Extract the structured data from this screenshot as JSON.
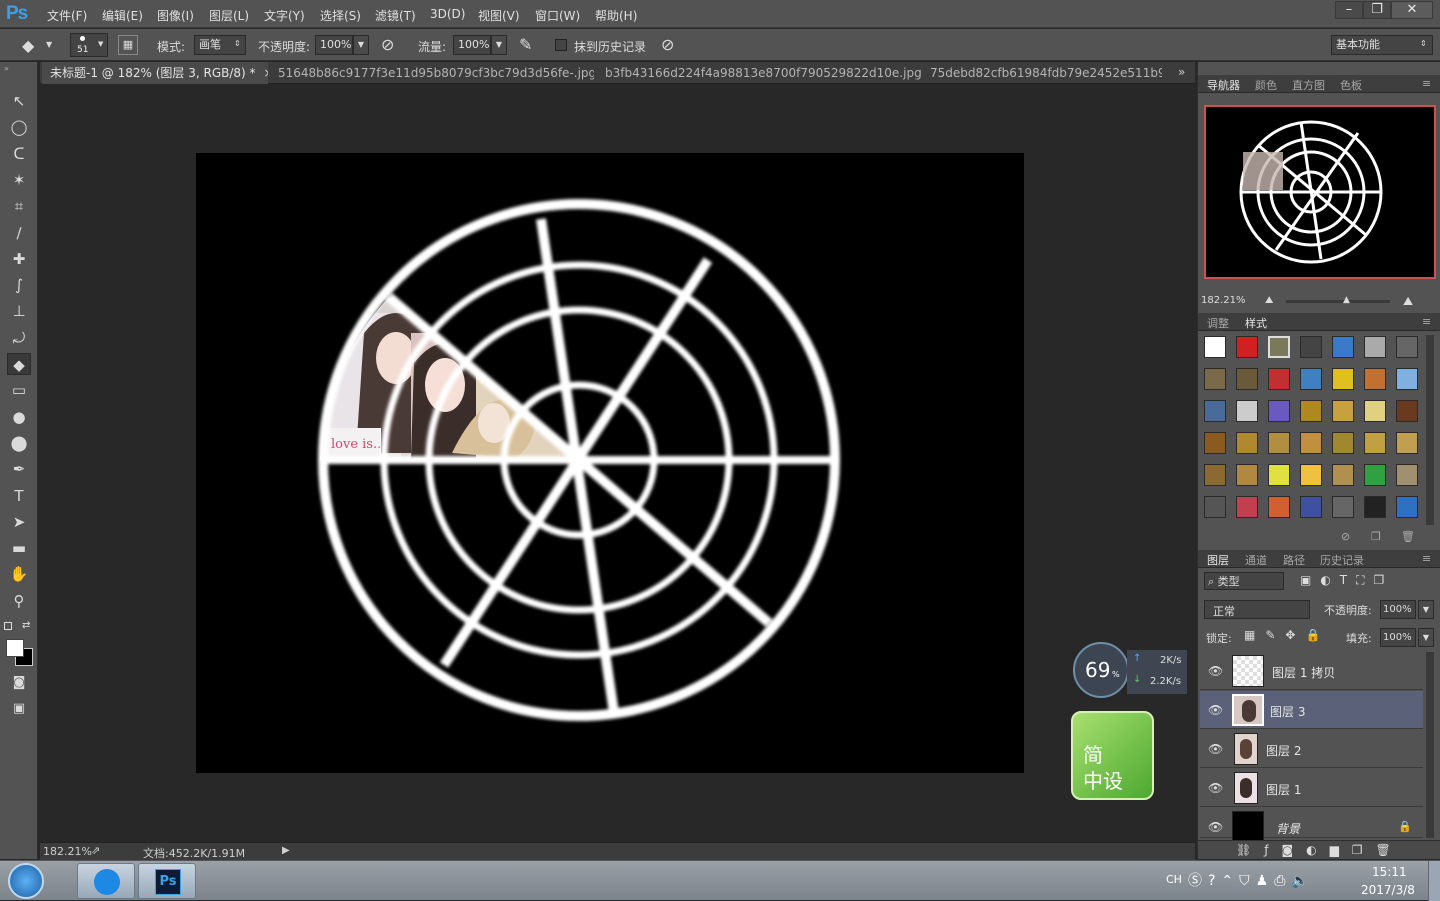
{
  "app": {
    "logo": "Ps"
  },
  "menu": [
    "文件(F)",
    "编辑(E)",
    "图像(I)",
    "图层(L)",
    "文字(Y)",
    "选择(S)",
    "滤镜(T)",
    "3D(D)",
    "视图(V)",
    "窗口(W)",
    "帮助(H)"
  ],
  "window_controls": {
    "minimize": "–",
    "restore": "❐",
    "close": "✕"
  },
  "options": {
    "brush_size": "51",
    "mode_label": "模式:",
    "mode_value": "画笔",
    "opacity_label": "不透明度:",
    "opacity_value": "100%",
    "flow_label": "流量:",
    "flow_value": "100%",
    "erase_history_label": "抹到历史记录",
    "workspace": "基本功能"
  },
  "tabs": [
    {
      "label": "未标题-1 @ 182% (图层 3, RGB/8) *",
      "close": "×"
    },
    {
      "label": "51648b86c9177f3e11d95b8079cf3bc79d3d56fe-.jpg",
      "close": "×"
    },
    {
      "label": "b3fb43166d224f4a98813e8700f790529822d10e.jpg",
      "close": "×"
    },
    {
      "label": "75debd82cfb61984fdb79e2452e511b9_b",
      "close": ""
    }
  ],
  "tabs_overflow": "»",
  "tools": [
    "move-tool",
    "ellipse-marquee-tool",
    "lasso-tool",
    "magic-wand-tool",
    "crop-tool",
    "eyedropper-tool",
    "healing-brush-tool",
    "brush-tool",
    "clone-stamp-tool",
    "history-brush-tool",
    "eraser-tool",
    "gradient-tool",
    "blur-tool",
    "dodge-tool",
    "pen-tool",
    "type-tool",
    "path-selection-tool",
    "rectangle-tool",
    "hand-tool",
    "zoom-tool"
  ],
  "tool_glyphs": [
    "↖",
    "◯",
    "ᑕ",
    "✶",
    "⌗",
    "∕",
    "✚",
    "∫",
    "⊥",
    "⤾",
    "◆",
    "▭",
    "●",
    "⬤",
    "✒",
    "T",
    "➤",
    "▬",
    "✋",
    "⚲"
  ],
  "status": {
    "zoom": "182.21%",
    "doc": "文档:452.2K/1.91M"
  },
  "navigator": {
    "tabs": [
      "导航器",
      "颜色",
      "直方图",
      "色板"
    ],
    "zoom": "182.21%"
  },
  "styles_panel": {
    "tabs": [
      "调整",
      "样式"
    ]
  },
  "layers_panel": {
    "tabs": [
      "图层",
      "通道",
      "路径",
      "历史记录"
    ],
    "filter": "类型",
    "blend_mode": "正常",
    "opacity_label": "不透明度:",
    "opacity_value": "100%",
    "lock_label": "锁定:",
    "fill_label": "填充:",
    "fill_value": "100%",
    "layers": [
      {
        "name": "图层 1 拷贝",
        "selected": false
      },
      {
        "name": "图层 3",
        "selected": true
      },
      {
        "name": "图层 2",
        "selected": false
      },
      {
        "name": "图层 1",
        "selected": false
      },
      {
        "name": "背景",
        "selected": false,
        "locked": true
      }
    ]
  },
  "speed_widget": {
    "percent": "69",
    "percent_unit": "%",
    "up": "2K/s",
    "down": "2.2K/s"
  },
  "floating_app": {
    "line1": "简",
    "line2": "中设"
  },
  "canvas_text": "love is...",
  "taskbar": {
    "lang": "CH",
    "time": "15:11",
    "date": "2017/3/8"
  }
}
